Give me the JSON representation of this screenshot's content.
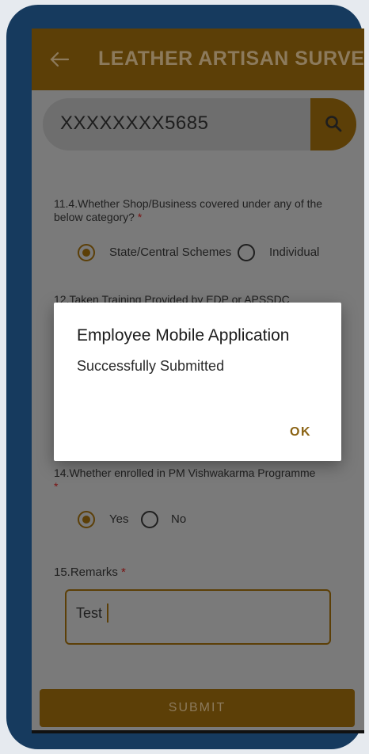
{
  "app_bar": {
    "title": "LEATHER ARTISAN SURVEY",
    "back_icon": "arrow-left-icon"
  },
  "search": {
    "value": "XXXXXXXX5685",
    "button_icon": "search-icon"
  },
  "form": {
    "q11_4": {
      "label": "11.4.Whether Shop/Business covered under any of the below category?",
      "required": "*",
      "options": [
        "State/Central Schemes",
        "Individual"
      ],
      "selected": "State/Central Schemes"
    },
    "q12": {
      "label_partial": "12.Taken Training Provided by EDP or APSSDC"
    },
    "q14": {
      "label": "14.Whether enrolled in PM Vishwakarma Programme",
      "required": "*",
      "options": [
        "Yes",
        "No"
      ],
      "selected": "Yes"
    },
    "q15": {
      "label": "15.Remarks",
      "required": "*",
      "value": "Test"
    },
    "submit_label": "SUBMIT"
  },
  "dialog": {
    "title": "Employee Mobile Application",
    "message": "Successfully Submitted",
    "ok_label": "OK"
  },
  "colors": {
    "primary": "#5c3f07",
    "required": "#7a1212",
    "frame": "#163a5e",
    "scrim_bg": "#7a7a7a"
  }
}
